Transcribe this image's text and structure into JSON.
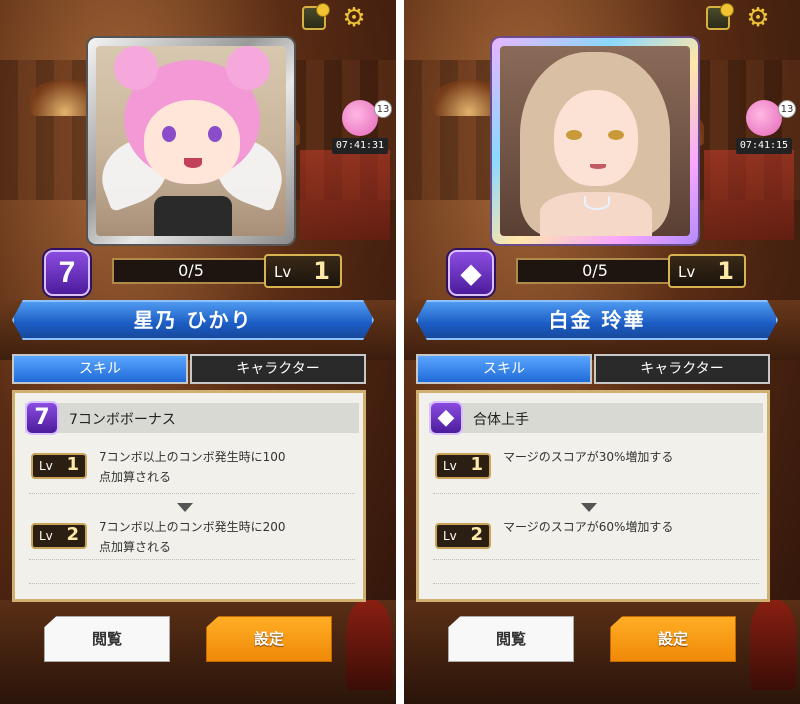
{
  "panels": [
    {
      "character_name": "星乃 ひかり",
      "rank": "7",
      "progress": "0/5",
      "level_label": "Lv",
      "level_value": "1",
      "timer": {
        "count": "13",
        "time": "07:41:31"
      },
      "tabs": {
        "skill": "スキル",
        "character": "キャラクター"
      },
      "skill": {
        "icon_text": "7",
        "name": "7コンボボーナス",
        "levels": [
          {
            "label": "Lv",
            "value": "1",
            "desc_line1": "7コンボ以上のコンボ発生時に100",
            "desc_line2": "点加算される"
          },
          {
            "label": "Lv",
            "value": "2",
            "desc_line1": "7コンボ以上のコンボ発生時に200",
            "desc_line2": "点加算される"
          }
        ]
      },
      "buttons": {
        "view": "閲覧",
        "settings": "設定"
      }
    },
    {
      "character_name": "白金 玲華",
      "rank": "",
      "progress": "0/5",
      "level_label": "Lv",
      "level_value": "1",
      "timer": {
        "count": "13",
        "time": "07:41:15"
      },
      "tabs": {
        "skill": "スキル",
        "character": "キャラクター"
      },
      "skill": {
        "icon_text": "",
        "name": "合体上手",
        "levels": [
          {
            "label": "Lv",
            "value": "1",
            "desc_line1": "マージのスコアが30%増加する",
            "desc_line2": ""
          },
          {
            "label": "Lv",
            "value": "2",
            "desc_line1": "マージのスコアが60%増加する",
            "desc_line2": ""
          }
        ]
      },
      "buttons": {
        "view": "閲覧",
        "settings": "設定"
      }
    }
  ],
  "colors": {
    "accent_blue": "#1f6ad8",
    "rank_purple": "#6a2cc0",
    "settings_orange": "#f5960f"
  },
  "icons": [
    "shop-icon",
    "gear-icon",
    "rank-badge-icon",
    "merge-skill-icon"
  ]
}
